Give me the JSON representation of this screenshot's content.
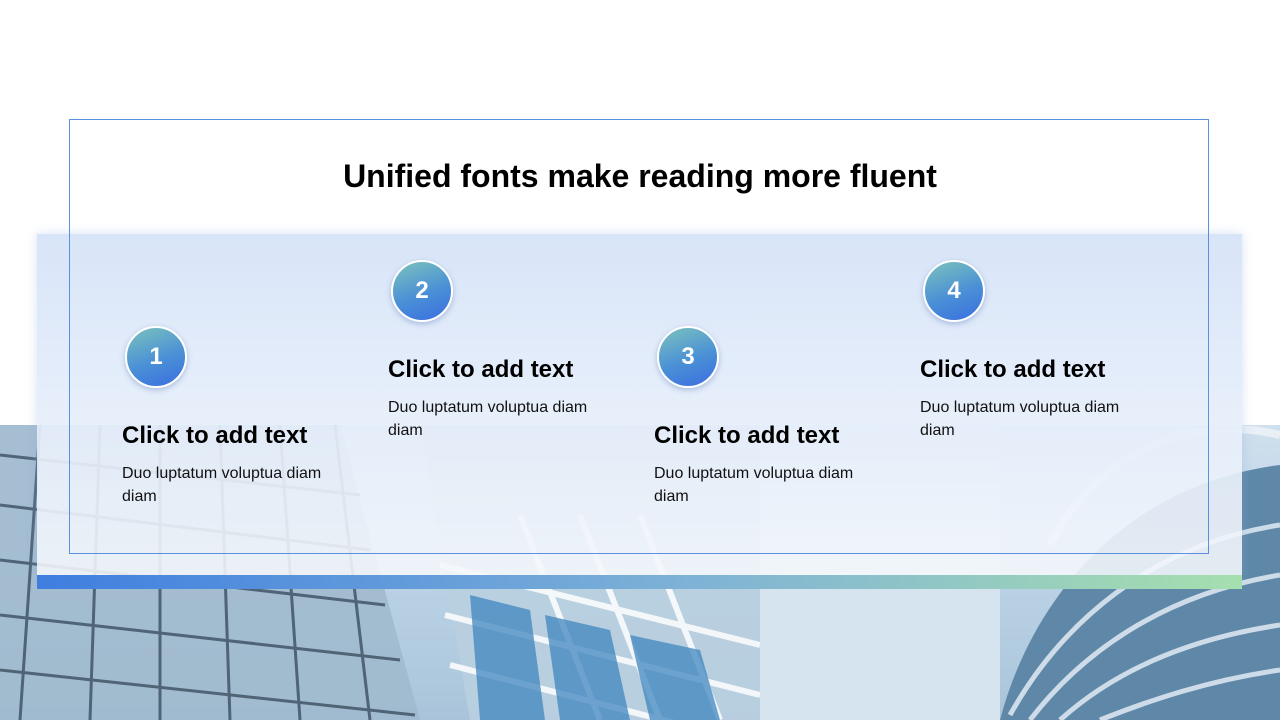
{
  "slide": {
    "title": "Unified fonts make reading more fluent",
    "colors": {
      "frame": "#5b8fe0",
      "badge_start": "#7cc3bd",
      "badge_end": "#3a6ee0",
      "stripe_start": "#3f7ee0",
      "stripe_end": "#a6dfae"
    },
    "steps": [
      {
        "number": "1",
        "heading": "Click to add text",
        "description": "Duo luptatum voluptua diam diam"
      },
      {
        "number": "2",
        "heading": "Click to add text",
        "description": "Duo luptatum voluptua diam diam"
      },
      {
        "number": "3",
        "heading": "Click to add text",
        "description": "Duo luptatum voluptua diam diam"
      },
      {
        "number": "4",
        "heading": "Click to add text",
        "description": "Duo luptatum voluptua diam diam"
      }
    ]
  }
}
